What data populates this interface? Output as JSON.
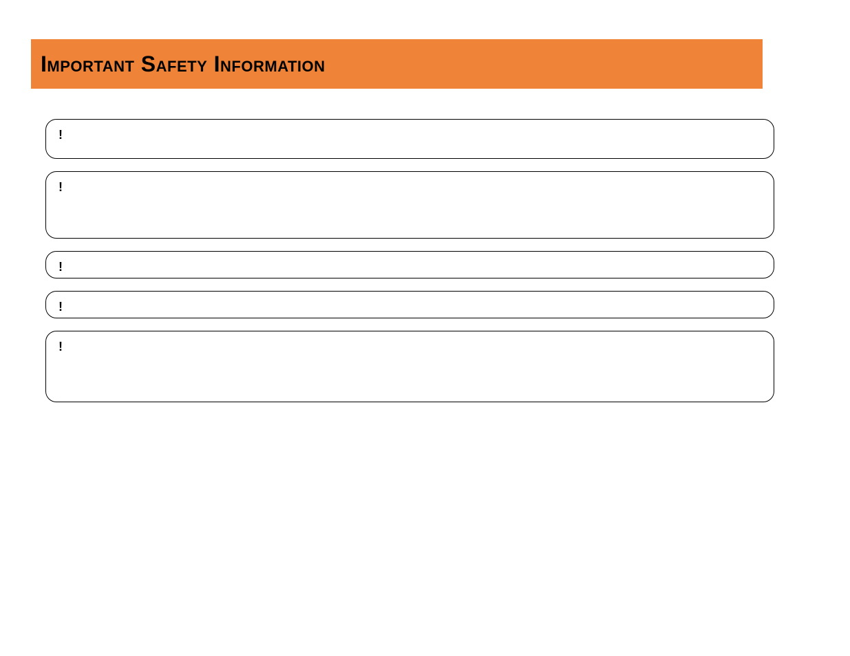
{
  "header": {
    "title": "Important Safety Information"
  },
  "boxes": [
    {
      "marker": "!",
      "content": ""
    },
    {
      "marker": "!",
      "content": ""
    },
    {
      "marker": "!",
      "content": ""
    },
    {
      "marker": "!",
      "content": ""
    },
    {
      "marker": "!",
      "content": ""
    }
  ]
}
